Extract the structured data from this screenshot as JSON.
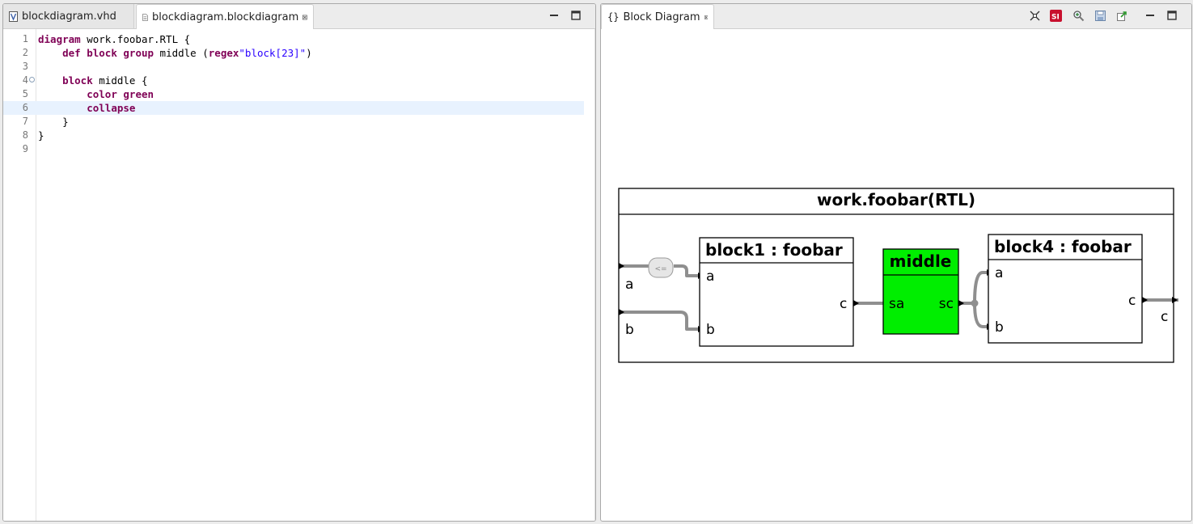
{
  "left": {
    "tabs": [
      {
        "label": "blockdiagram.vhd"
      },
      {
        "label": "blockdiagram.blockdiagram"
      }
    ],
    "lines": [
      {
        "n": "1",
        "tokens": [
          {
            "t": "diagram",
            "k": "kw"
          },
          {
            "t": " work.foobar.RTL {",
            "k": ""
          }
        ]
      },
      {
        "n": "2",
        "tokens": [
          {
            "t": "    ",
            "k": ""
          },
          {
            "t": "def",
            "k": "kw"
          },
          {
            "t": " ",
            "k": ""
          },
          {
            "t": "block",
            "k": "kw"
          },
          {
            "t": " ",
            "k": ""
          },
          {
            "t": "group",
            "k": "kw"
          },
          {
            "t": " middle (",
            "k": ""
          },
          {
            "t": "regex",
            "k": "kw"
          },
          {
            "t": "\"block[23]\"",
            "k": "str"
          },
          {
            "t": ")",
            "k": ""
          }
        ]
      },
      {
        "n": "3",
        "tokens": []
      },
      {
        "n": "4",
        "tokens": [
          {
            "t": "    ",
            "k": ""
          },
          {
            "t": "block",
            "k": "kw"
          },
          {
            "t": " middle {",
            "k": ""
          }
        ],
        "fold": true
      },
      {
        "n": "5",
        "tokens": [
          {
            "t": "        ",
            "k": ""
          },
          {
            "t": "color",
            "k": "kw"
          },
          {
            "t": " ",
            "k": ""
          },
          {
            "t": "green",
            "k": "kw"
          }
        ]
      },
      {
        "n": "6",
        "tokens": [
          {
            "t": "        ",
            "k": ""
          },
          {
            "t": "collapse",
            "k": "kw"
          }
        ],
        "current": true
      },
      {
        "n": "7",
        "tokens": [
          {
            "t": "    }",
            "k": ""
          }
        ]
      },
      {
        "n": "8",
        "tokens": [
          {
            "t": "}",
            "k": ""
          }
        ]
      },
      {
        "n": "9",
        "tokens": []
      }
    ]
  },
  "right": {
    "tab_label": "Block Diagram",
    "toolbar_icons": [
      "arrange-icon",
      "sirius-icon",
      "zoom-icon",
      "save-icon",
      "export-icon"
    ]
  },
  "diagram": {
    "title": "work.foobar(RTL)",
    "top_ports": [
      "a",
      "b"
    ],
    "top_out": "c",
    "op_label": "<=",
    "block1": {
      "title": "block1 : foobar",
      "in": [
        "a",
        "b"
      ],
      "out": "c"
    },
    "middle": {
      "title": "middle",
      "in": "sa",
      "out": "sc",
      "fill": "#00ee00"
    },
    "block4": {
      "title": "block4 : foobar",
      "in": [
        "a",
        "b"
      ],
      "out": "c"
    }
  },
  "colors": {
    "keyword": "#7f0055",
    "string": "#2a00ff",
    "current_line": "#e8f2fe",
    "wire": "#8f8f8f"
  }
}
